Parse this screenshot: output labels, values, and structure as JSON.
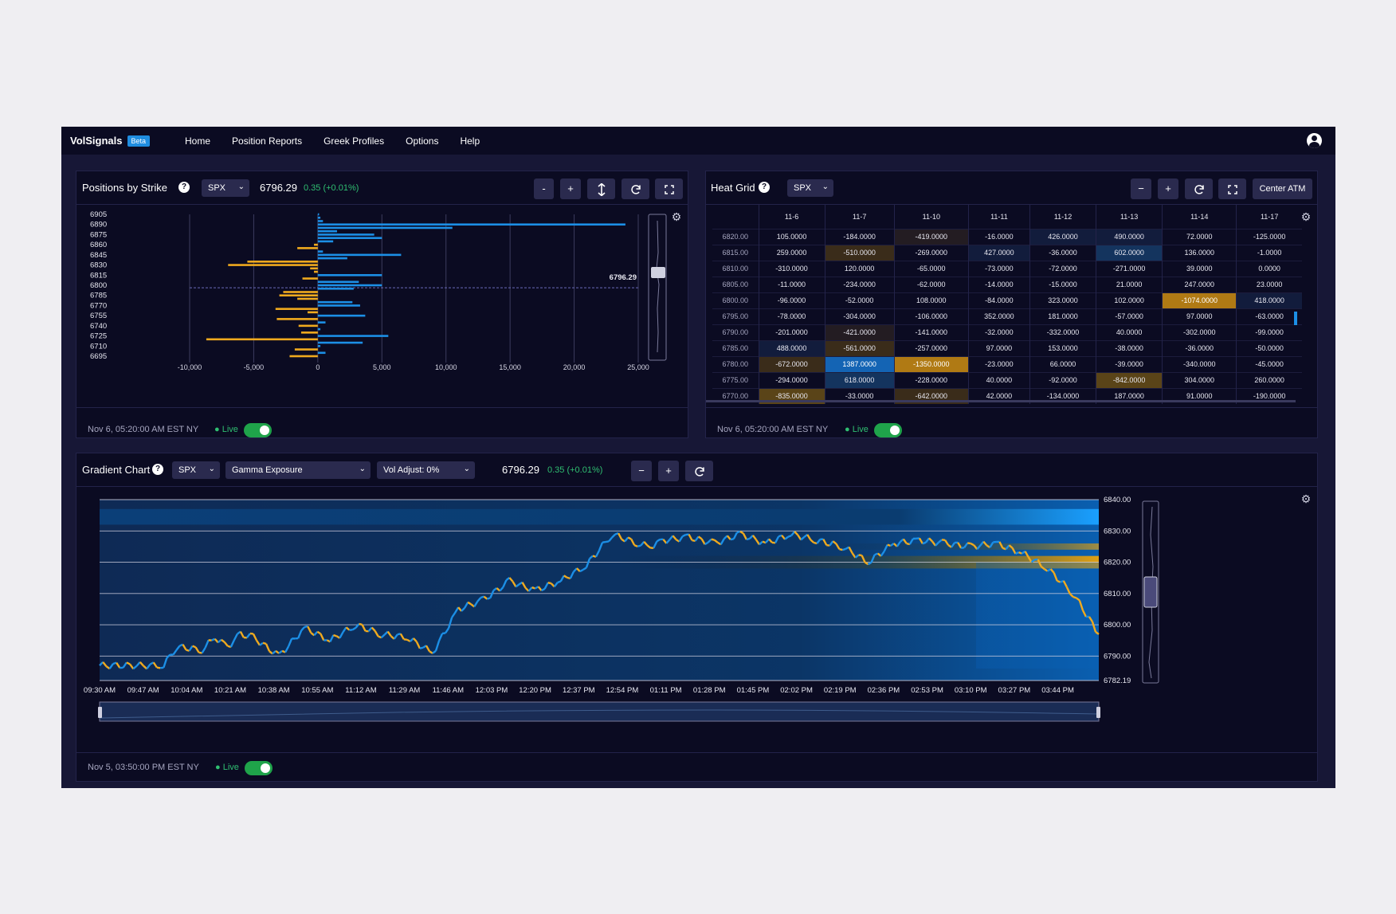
{
  "nav": {
    "brand": "VolSignals",
    "badge": "Beta",
    "links": [
      "Home",
      "Position Reports",
      "Greek Profiles",
      "Options",
      "Help"
    ]
  },
  "positions": {
    "title": "Positions by Strike",
    "ticker": "SPX",
    "price": "6796.29",
    "change": "0.35 (+0.01%)",
    "buttons": [
      "-",
      "+"
    ],
    "spot_label": "6796.29",
    "timestamp": "Nov 6, 05:20:00 AM EST NY",
    "live": "Live"
  },
  "heatgrid": {
    "title": "Heat Grid",
    "ticker": "SPX",
    "buttons": [
      "−",
      "+"
    ],
    "center_label": "Center ATM",
    "dates": [
      "11-6",
      "11-7",
      "11-10",
      "11-11",
      "11-12",
      "11-13",
      "11-14",
      "11-17"
    ],
    "rows": [
      {
        "strike": "6820.00",
        "vals": [
          "105.0000",
          "-184.0000",
          "-419.0000",
          "-16.0000",
          "426.0000",
          "490.0000",
          "72.0000",
          "-125.0000"
        ]
      },
      {
        "strike": "6815.00",
        "vals": [
          "259.0000",
          "-510.0000",
          "-269.0000",
          "427.0000",
          "-36.0000",
          "602.0000",
          "136.0000",
          "-1.0000"
        ]
      },
      {
        "strike": "6810.00",
        "vals": [
          "-310.0000",
          "120.0000",
          "-65.0000",
          "-73.0000",
          "-72.0000",
          "-271.0000",
          "39.0000",
          "0.0000"
        ]
      },
      {
        "strike": "6805.00",
        "vals": [
          "-11.0000",
          "-234.0000",
          "-62.0000",
          "-14.0000",
          "-15.0000",
          "21.0000",
          "247.0000",
          "23.0000"
        ]
      },
      {
        "strike": "6800.00",
        "vals": [
          "-96.0000",
          "-52.0000",
          "108.0000",
          "-84.0000",
          "323.0000",
          "102.0000",
          "-1074.0000",
          "418.0000"
        ]
      },
      {
        "strike": "6795.00",
        "vals": [
          "-78.0000",
          "-304.0000",
          "-106.0000",
          "352.0000",
          "181.0000",
          "-57.0000",
          "97.0000",
          "-63.0000"
        ]
      },
      {
        "strike": "6790.00",
        "vals": [
          "-201.0000",
          "-421.0000",
          "-141.0000",
          "-32.0000",
          "-332.0000",
          "40.0000",
          "-302.0000",
          "-99.0000"
        ]
      },
      {
        "strike": "6785.00",
        "vals": [
          "488.0000",
          "-561.0000",
          "-257.0000",
          "97.0000",
          "153.0000",
          "-38.0000",
          "-36.0000",
          "-50.0000"
        ]
      },
      {
        "strike": "6780.00",
        "vals": [
          "-672.0000",
          "1387.0000",
          "-1350.0000",
          "-23.0000",
          "66.0000",
          "-39.0000",
          "-340.0000",
          "-45.0000"
        ]
      },
      {
        "strike": "6775.00",
        "vals": [
          "-294.0000",
          "618.0000",
          "-228.0000",
          "40.0000",
          "-92.0000",
          "-842.0000",
          "304.0000",
          "260.0000"
        ]
      },
      {
        "strike": "6770.00",
        "vals": [
          "-835.0000",
          "-33.0000",
          "-642.0000",
          "42.0000",
          "-134.0000",
          "187.0000",
          "91.0000",
          "-190.0000"
        ]
      }
    ],
    "timestamp": "Nov 6, 05:20:00 AM EST NY",
    "live": "Live"
  },
  "gradient": {
    "title": "Gradient Chart",
    "ticker": "SPX",
    "metric": "Gamma Exposure",
    "vol_adjust": "Vol Adjust: 0%",
    "price": "6796.29",
    "change": "0.35 (+0.01%)",
    "buttons": [
      "−",
      "+"
    ],
    "timestamp": "Nov 5, 03:50:00 PM EST NY",
    "live": "Live"
  },
  "chart_data": [
    {
      "type": "bar",
      "orientation": "horizontal",
      "y_tick_labels": [
        "6905",
        "6890",
        "6875",
        "6860",
        "6845",
        "6830",
        "6815",
        "6800",
        "6785",
        "6770",
        "6755",
        "6740",
        "6725",
        "6710",
        "6695"
      ],
      "x_tick_labels": [
        "-10,000",
        "-5,000",
        "0",
        "5,000",
        "10,000",
        "15,000",
        "20,000",
        "25,000"
      ],
      "xlim": [
        -10000,
        25000
      ],
      "ylim": [
        6695,
        6905
      ],
      "spot": 6796.29,
      "colors": {
        "positive": "#1c8fe6",
        "negative": "#f0aa1e"
      },
      "strikes": [
        6905,
        6900,
        6895,
        6890,
        6885,
        6880,
        6875,
        6870,
        6865,
        6860,
        6855,
        6850,
        6845,
        6840,
        6835,
        6830,
        6825,
        6820,
        6815,
        6810,
        6805,
        6800,
        6795,
        6790,
        6785,
        6780,
        6775,
        6770,
        6765,
        6760,
        6755,
        6750,
        6745,
        6740,
        6735,
        6730,
        6725,
        6720,
        6715,
        6710,
        6705,
        6700,
        6695
      ],
      "values": [
        100,
        200,
        400,
        24000,
        10500,
        1500,
        4400,
        5000,
        1200,
        -300,
        -1600,
        400,
        6500,
        2300,
        -5500,
        -7000,
        -600,
        -300,
        5000,
        -1200,
        3200,
        5000,
        2800,
        -2700,
        -3000,
        -1600,
        2700,
        3300,
        -3300,
        -800,
        3700,
        -3200,
        600,
        -1500,
        200,
        -1300,
        5500,
        -8700,
        3500,
        200,
        -1800,
        600,
        -2200
      ]
    },
    {
      "type": "line",
      "title": "Gamma Exposure",
      "x_tick_labels": [
        "09:30 AM",
        "09:47 AM",
        "10:04 AM",
        "10:21 AM",
        "10:38 AM",
        "10:55 AM",
        "11:12 AM",
        "11:29 AM",
        "11:46 AM",
        "12:03 PM",
        "12:20 PM",
        "12:37 PM",
        "12:54 PM",
        "01:11 PM",
        "01:28 PM",
        "01:45 PM",
        "02:02 PM",
        "02:19 PM",
        "02:36 PM",
        "02:53 PM",
        "03:10 PM",
        "03:27 PM",
        "03:44 PM"
      ],
      "y_tick_labels": [
        "6840.00",
        "6830.00",
        "6820.00",
        "6810.00",
        "6800.00",
        "6790.00",
        "6782.19"
      ],
      "ylim": [
        6782.19,
        6840
      ],
      "colors": {
        "up": "#1c8fe6",
        "down": "#f0aa1e"
      },
      "x_minutes": [
        0,
        25,
        30,
        40,
        45,
        50,
        55,
        60,
        70,
        80,
        90,
        100,
        110,
        120,
        130,
        140,
        150,
        160,
        170,
        180,
        190,
        200,
        210,
        215,
        220,
        230,
        240,
        250,
        260,
        270,
        280,
        290,
        300,
        310,
        320,
        330,
        340,
        350,
        360,
        370,
        380,
        390
      ],
      "y": [
        6787,
        6787,
        6793,
        6792,
        6796,
        6793,
        6797,
        6796,
        6790,
        6799,
        6795,
        6800,
        6797,
        6796,
        6791,
        6805,
        6808,
        6814,
        6811,
        6814,
        6819,
        6829,
        6826,
        6825,
        6827,
        6828,
        6826,
        6829,
        6826,
        6829,
        6827,
        6825,
        6820,
        6826,
        6827,
        6826,
        6825,
        6826,
        6823,
        6818,
        6810,
        6797
      ]
    }
  ]
}
